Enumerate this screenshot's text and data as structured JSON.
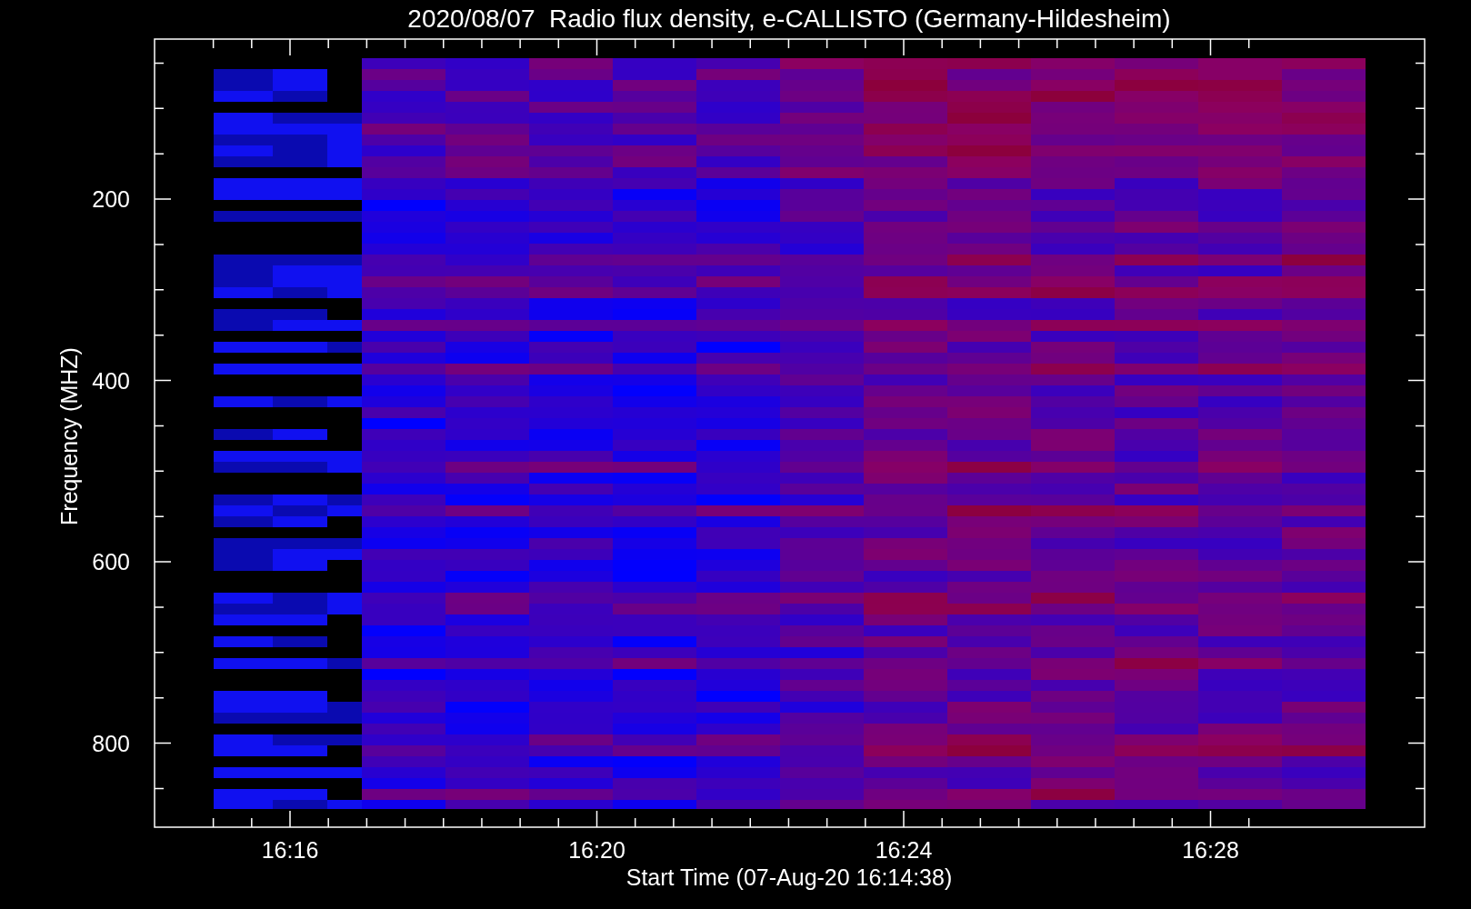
{
  "title": "2020/08/07  Radio flux density, e-CALLISTO (Germany-Hildesheim)",
  "plot": {
    "xlabel": "Start Time (07-Aug-20 16:14:38)",
    "ylabel": "Frequency (MHZ)",
    "xticks": [
      "16:16",
      "16:20",
      "16:24",
      "16:28"
    ],
    "yticks": [
      "200",
      "400",
      "600",
      "800"
    ]
  }
}
